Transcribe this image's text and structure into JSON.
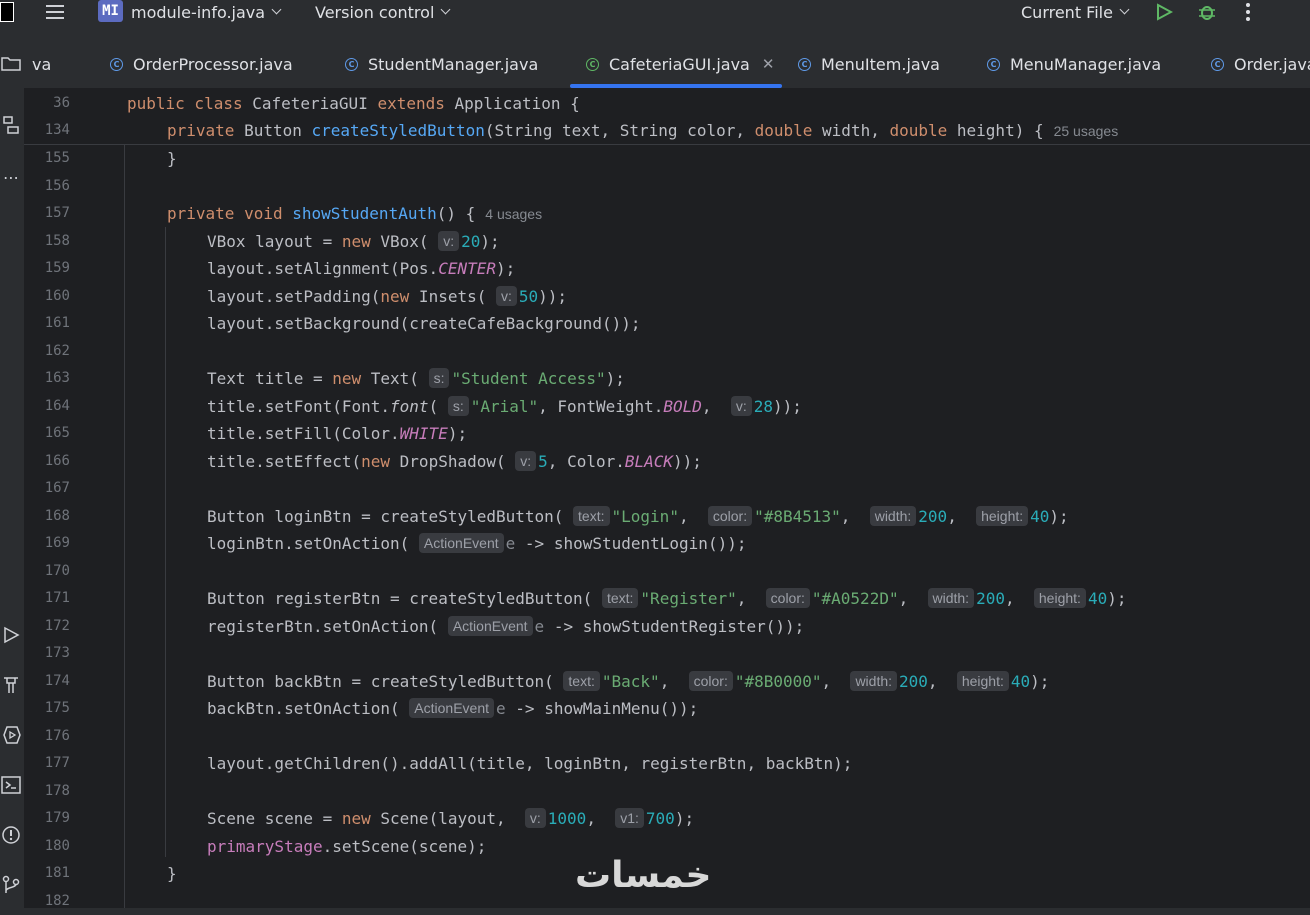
{
  "topbar": {
    "project_badge": "MI",
    "project_name": "module-info.java",
    "version_control": "Version control",
    "run_config": "Current File"
  },
  "tabs": [
    {
      "label": "va"
    },
    {
      "label": "OrderProcessor.java"
    },
    {
      "label": "StudentManager.java"
    },
    {
      "label": "CafeteriaGUI.java",
      "active": true
    },
    {
      "label": "MenuItem.java"
    },
    {
      "label": "MenuManager.java"
    },
    {
      "label": "Order.java"
    }
  ],
  "sticky": {
    "line36_num": "36",
    "line134_num": "134",
    "line134_usages": "25 usages"
  },
  "editor": {
    "line_numbers": [
      "155",
      "156",
      "157",
      "158",
      "159",
      "160",
      "161",
      "162",
      "163",
      "164",
      "165",
      "166",
      "167",
      "168",
      "169",
      "170",
      "171",
      "172",
      "173",
      "174",
      "175",
      "176",
      "177",
      "178",
      "179",
      "180",
      "181",
      "182"
    ],
    "usages_157": "4 usages"
  },
  "watermark": "خمسات",
  "colors": {
    "keyword": "#cf8e6d",
    "function": "#56a8f5",
    "string": "#6aab73",
    "number": "#2aacb8",
    "constant": "#c77dbb",
    "accent": "#3574f0"
  }
}
